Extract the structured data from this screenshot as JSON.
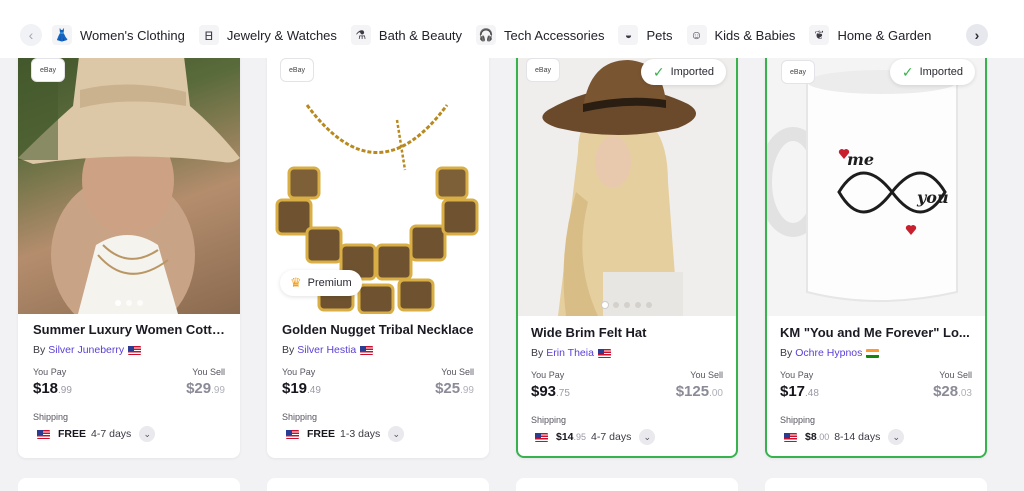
{
  "categories": [
    {
      "label": "Women's Clothing",
      "icon": "dress-icon"
    },
    {
      "label": "Jewelry & Watches",
      "icon": "necklace-icon"
    },
    {
      "label": "Bath & Beauty",
      "icon": "bottle-icon"
    },
    {
      "label": "Tech Accessories",
      "icon": "headphones-icon"
    },
    {
      "label": "Pets",
      "icon": "pet-bowl-icon"
    },
    {
      "label": "Kids & Babies",
      "icon": "baby-icon"
    },
    {
      "label": "Home & Garden",
      "icon": "plant-icon"
    }
  ],
  "nav": {
    "prev": "‹",
    "next": "›"
  },
  "shop_logo_text": "eBay",
  "labels": {
    "you_pay": "You Pay",
    "you_sell": "You Sell",
    "shipping": "Shipping",
    "by": "By",
    "imported": "Imported",
    "premium": "Premium"
  },
  "products": [
    {
      "title": "Summer Luxury Women Cotto...",
      "seller": "Silver Juneberry",
      "flag": "us",
      "pay_dollars": "$18",
      "pay_cents": ".99",
      "sell_dollars": "$29",
      "sell_cents": ".99",
      "ship_price": "FREE",
      "ship_cents": "",
      "ship_days": "4-7 days",
      "imported": false,
      "premium": false,
      "dots": 3,
      "active_dot": 0
    },
    {
      "title": "Golden Nugget Tribal Necklace",
      "seller": "Silver Hestia",
      "flag": "us",
      "pay_dollars": "$19",
      "pay_cents": ".49",
      "sell_dollars": "$25",
      "sell_cents": ".99",
      "ship_price": "FREE",
      "ship_cents": "",
      "ship_days": "1-3 days",
      "imported": false,
      "premium": true,
      "dots": 0,
      "active_dot": 0
    },
    {
      "title": "Wide Brim Felt Hat",
      "seller": "Erin Theia",
      "flag": "us",
      "pay_dollars": "$93",
      "pay_cents": ".75",
      "sell_dollars": "$125",
      "sell_cents": ".00",
      "ship_price": "$14",
      "ship_cents": ".95",
      "ship_days": "4-7 days",
      "imported": true,
      "premium": false,
      "dots": 5,
      "active_dot": 0
    },
    {
      "title": "KM \"You and Me Forever\" Lo...",
      "seller": "Ochre Hypnos",
      "flag": "in",
      "pay_dollars": "$17",
      "pay_cents": ".48",
      "sell_dollars": "$28",
      "sell_cents": ".03",
      "ship_price": "$8",
      "ship_cents": ".00",
      "ship_days": "8-14 days",
      "imported": true,
      "premium": false,
      "dots": 0,
      "active_dot": 0
    }
  ],
  "mug_text": {
    "top": "me",
    "bottom": "you"
  },
  "colors": {
    "imported_border": "#37b24d",
    "seller_link": "#5b3fd6",
    "premium_crown": "#f0a020"
  }
}
